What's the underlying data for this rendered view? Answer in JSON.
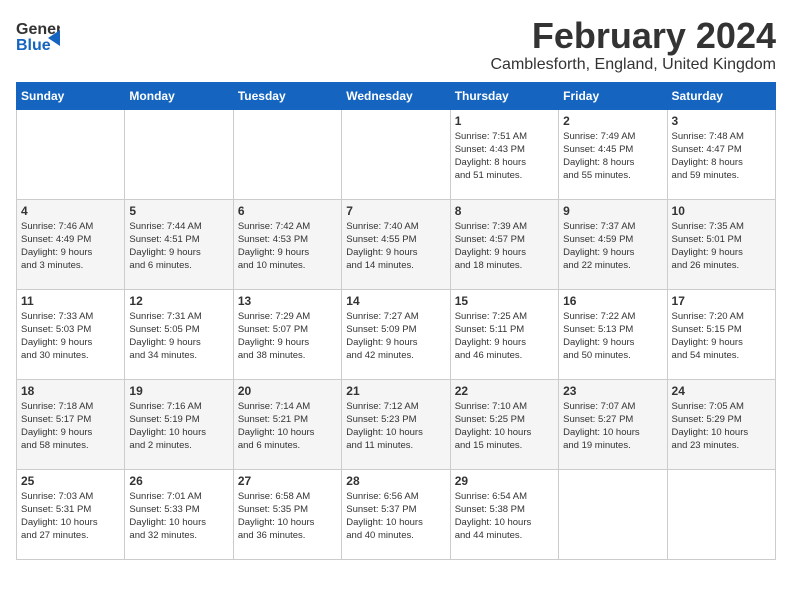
{
  "header": {
    "logo_general": "General",
    "logo_blue": "Blue",
    "month_title": "February 2024",
    "location": "Camblesforth, England, United Kingdom"
  },
  "days_of_week": [
    "Sunday",
    "Monday",
    "Tuesday",
    "Wednesday",
    "Thursday",
    "Friday",
    "Saturday"
  ],
  "weeks": [
    [
      {
        "day": "",
        "content": ""
      },
      {
        "day": "",
        "content": ""
      },
      {
        "day": "",
        "content": ""
      },
      {
        "day": "",
        "content": ""
      },
      {
        "day": "1",
        "content": "Sunrise: 7:51 AM\nSunset: 4:43 PM\nDaylight: 8 hours\nand 51 minutes."
      },
      {
        "day": "2",
        "content": "Sunrise: 7:49 AM\nSunset: 4:45 PM\nDaylight: 8 hours\nand 55 minutes."
      },
      {
        "day": "3",
        "content": "Sunrise: 7:48 AM\nSunset: 4:47 PM\nDaylight: 8 hours\nand 59 minutes."
      }
    ],
    [
      {
        "day": "4",
        "content": "Sunrise: 7:46 AM\nSunset: 4:49 PM\nDaylight: 9 hours\nand 3 minutes."
      },
      {
        "day": "5",
        "content": "Sunrise: 7:44 AM\nSunset: 4:51 PM\nDaylight: 9 hours\nand 6 minutes."
      },
      {
        "day": "6",
        "content": "Sunrise: 7:42 AM\nSunset: 4:53 PM\nDaylight: 9 hours\nand 10 minutes."
      },
      {
        "day": "7",
        "content": "Sunrise: 7:40 AM\nSunset: 4:55 PM\nDaylight: 9 hours\nand 14 minutes."
      },
      {
        "day": "8",
        "content": "Sunrise: 7:39 AM\nSunset: 4:57 PM\nDaylight: 9 hours\nand 18 minutes."
      },
      {
        "day": "9",
        "content": "Sunrise: 7:37 AM\nSunset: 4:59 PM\nDaylight: 9 hours\nand 22 minutes."
      },
      {
        "day": "10",
        "content": "Sunrise: 7:35 AM\nSunset: 5:01 PM\nDaylight: 9 hours\nand 26 minutes."
      }
    ],
    [
      {
        "day": "11",
        "content": "Sunrise: 7:33 AM\nSunset: 5:03 PM\nDaylight: 9 hours\nand 30 minutes."
      },
      {
        "day": "12",
        "content": "Sunrise: 7:31 AM\nSunset: 5:05 PM\nDaylight: 9 hours\nand 34 minutes."
      },
      {
        "day": "13",
        "content": "Sunrise: 7:29 AM\nSunset: 5:07 PM\nDaylight: 9 hours\nand 38 minutes."
      },
      {
        "day": "14",
        "content": "Sunrise: 7:27 AM\nSunset: 5:09 PM\nDaylight: 9 hours\nand 42 minutes."
      },
      {
        "day": "15",
        "content": "Sunrise: 7:25 AM\nSunset: 5:11 PM\nDaylight: 9 hours\nand 46 minutes."
      },
      {
        "day": "16",
        "content": "Sunrise: 7:22 AM\nSunset: 5:13 PM\nDaylight: 9 hours\nand 50 minutes."
      },
      {
        "day": "17",
        "content": "Sunrise: 7:20 AM\nSunset: 5:15 PM\nDaylight: 9 hours\nand 54 minutes."
      }
    ],
    [
      {
        "day": "18",
        "content": "Sunrise: 7:18 AM\nSunset: 5:17 PM\nDaylight: 9 hours\nand 58 minutes."
      },
      {
        "day": "19",
        "content": "Sunrise: 7:16 AM\nSunset: 5:19 PM\nDaylight: 10 hours\nand 2 minutes."
      },
      {
        "day": "20",
        "content": "Sunrise: 7:14 AM\nSunset: 5:21 PM\nDaylight: 10 hours\nand 6 minutes."
      },
      {
        "day": "21",
        "content": "Sunrise: 7:12 AM\nSunset: 5:23 PM\nDaylight: 10 hours\nand 11 minutes."
      },
      {
        "day": "22",
        "content": "Sunrise: 7:10 AM\nSunset: 5:25 PM\nDaylight: 10 hours\nand 15 minutes."
      },
      {
        "day": "23",
        "content": "Sunrise: 7:07 AM\nSunset: 5:27 PM\nDaylight: 10 hours\nand 19 minutes."
      },
      {
        "day": "24",
        "content": "Sunrise: 7:05 AM\nSunset: 5:29 PM\nDaylight: 10 hours\nand 23 minutes."
      }
    ],
    [
      {
        "day": "25",
        "content": "Sunrise: 7:03 AM\nSunset: 5:31 PM\nDaylight: 10 hours\nand 27 minutes."
      },
      {
        "day": "26",
        "content": "Sunrise: 7:01 AM\nSunset: 5:33 PM\nDaylight: 10 hours\nand 32 minutes."
      },
      {
        "day": "27",
        "content": "Sunrise: 6:58 AM\nSunset: 5:35 PM\nDaylight: 10 hours\nand 36 minutes."
      },
      {
        "day": "28",
        "content": "Sunrise: 6:56 AM\nSunset: 5:37 PM\nDaylight: 10 hours\nand 40 minutes."
      },
      {
        "day": "29",
        "content": "Sunrise: 6:54 AM\nSunset: 5:38 PM\nDaylight: 10 hours\nand 44 minutes."
      },
      {
        "day": "",
        "content": ""
      },
      {
        "day": "",
        "content": ""
      }
    ]
  ]
}
